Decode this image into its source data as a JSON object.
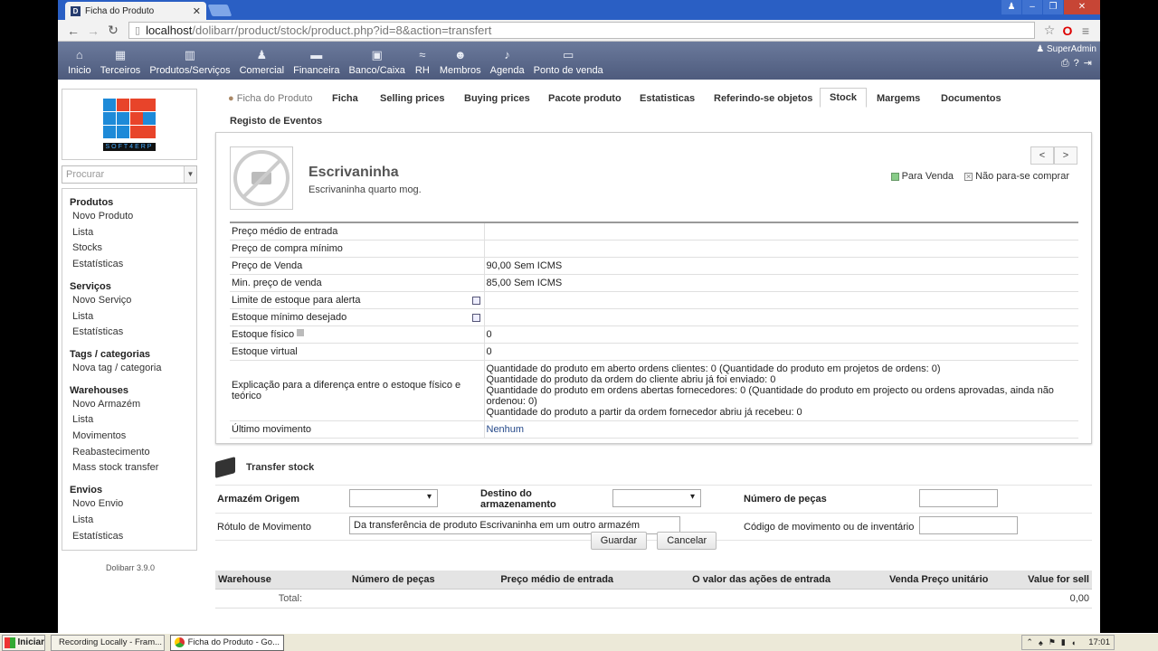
{
  "browser": {
    "tab_title": "Ficha do Produto",
    "url_host": "localhost",
    "url_path": "/dolibarr/product/stock/product.php?id=8&action=transfert"
  },
  "topmenu": {
    "items": [
      {
        "label": "Inicio",
        "icon": "home-icon"
      },
      {
        "label": "Terceiros",
        "icon": "company-icon"
      },
      {
        "label": "Produtos/Serviços",
        "icon": "products-icon"
      },
      {
        "label": "Comercial",
        "icon": "commercial-icon"
      },
      {
        "label": "Financeira",
        "icon": "finance-icon"
      },
      {
        "label": "Banco/Caixa",
        "icon": "bank-icon"
      },
      {
        "label": "RH",
        "icon": "hr-icon"
      },
      {
        "label": "Membros",
        "icon": "members-icon"
      },
      {
        "label": "Agenda",
        "icon": "agenda-icon"
      },
      {
        "label": "Ponto de venda",
        "icon": "pos-icon"
      }
    ],
    "user": "SuperAdmin"
  },
  "left": {
    "logo_text": "SOFT4ERP",
    "search_placeholder": "Procurar",
    "sections": [
      {
        "title": "Produtos",
        "items": [
          "Novo Produto",
          "Lista",
          "Stocks",
          "Estatísticas"
        ]
      },
      {
        "title": "Serviços",
        "items": [
          "Novo Serviço",
          "Lista",
          "Estatísticas"
        ]
      },
      {
        "title": "Tags / categorias",
        "items": [
          "Nova tag / categoria"
        ]
      },
      {
        "title": "Warehouses",
        "items": [
          "Novo Armazém",
          "Lista",
          "Movimentos",
          "Reabastecimento",
          "Mass stock transfer"
        ]
      },
      {
        "title": "Envios",
        "items": [
          "Novo Envio",
          "Lista",
          "Estatísticas"
        ]
      }
    ],
    "version": "Dolibarr 3.9.0"
  },
  "tabs": [
    "Ficha do Produto",
    "Ficha",
    "Selling prices",
    "Buying prices",
    "Pacote produto",
    "Estatisticas",
    "Referindo-se objetos",
    "Stock",
    "Margems",
    "Documentos",
    "Registo de Eventos"
  ],
  "product": {
    "name": "Escrivaninha",
    "description": "Escrivaninha quarto mog.",
    "status_sell": "Para Venda",
    "status_buy": "Não para-se comprar",
    "prev": "<",
    "next": ">"
  },
  "info_rows": [
    {
      "label": "Preço médio de entrada",
      "value": ""
    },
    {
      "label": "Preço de compra mínimo",
      "value": ""
    },
    {
      "label": "Preço de Venda",
      "value": "90,00 Sem ICMS"
    },
    {
      "label": "Min. preço de venda",
      "value": "85,00 Sem ICMS"
    },
    {
      "label": "Limite de estoque para alerta",
      "value": ""
    },
    {
      "label": "Estoque mínimo desejado",
      "value": ""
    },
    {
      "label": "Estoque físico",
      "value": "0"
    },
    {
      "label": "Estoque virtual",
      "value": "0"
    },
    {
      "label": "Explicação para a diferença entre o estoque físico e teórico",
      "value": ""
    },
    {
      "label": "Último movimento",
      "value": "Nenhum"
    }
  ],
  "explanation": [
    "Quantidade do produto em aberto ordens clientes: 0 (Quantidade do produto em projetos de ordens: 0)",
    "Quantidade do produto da ordem do cliente abriu já foi enviado: 0",
    "Quantidade do produto em ordens abertas fornecedores: 0 (Quantidade do produto em projecto ou ordens aprovadas, ainda não ordenou: 0)",
    "Quantidade do produto a partir da ordem fornecedor abriu já recebeu: 0"
  ],
  "transfer": {
    "title": "Transfer stock",
    "origin_label": "Armazém Origem",
    "dest_label": "Destino do armazenamento",
    "qty_label": "Número de peças",
    "movement_label": "Rótulo de Movimento",
    "movement_value": "Da transferência de produto Escrivaninha em um outro armazém",
    "code_label": "Código de movimento ou de inventário",
    "save": "Guardar",
    "cancel": "Cancelar"
  },
  "warehouse_table": {
    "headers": [
      "Warehouse",
      "Número de peças",
      "Preço médio de entrada",
      "O valor das ações de entrada",
      "Venda Preço unitário",
      "Value for sell"
    ],
    "total_label": "Total:",
    "total_value": "0,00"
  },
  "taskbar": {
    "start": "Iniciar",
    "tasks": [
      "Recording Locally - Fram...",
      "Ficha do Produto - Go..."
    ],
    "clock": "17:01"
  }
}
